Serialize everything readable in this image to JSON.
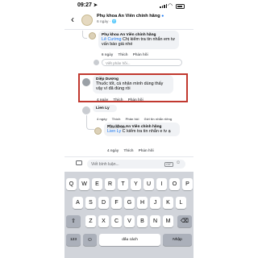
{
  "status_bar": {
    "time": "09:27",
    "arrow": "➤"
  },
  "header": {
    "back": "‹",
    "page_name": "Phụ khoa An Viên chính hãng",
    "verified": "●",
    "meta": "6 ngày · 🌐"
  },
  "comments": {
    "brand_reply": {
      "author": "Phụ khoa An Viên chính hãng",
      "mention": "Lê Cường",
      "text": " Chị kiểm tra tin nhắn em tư vấn báo giá nhé",
      "actions": [
        "6 ngày",
        "Thích",
        "Phản hồi"
      ]
    },
    "reply_placeholder": "Viết phản hồi...",
    "highlighted": {
      "author": "Diệp Dương",
      "text": "Thuốc tốt, cá nhân mình dùng thấy vậy ví đã đúng rồi",
      "actions": [
        "4 ngày",
        "Thích",
        "Phản hồi"
      ]
    },
    "lien": {
      "author": "Lien Ly",
      "actions": [
        "4 ngày",
        "Thích",
        "Phản hồi",
        "Gửi tin nhắn riêng"
      ]
    },
    "brand_reply_2": {
      "badge": "Fan tích cực",
      "author": "Phụ khoa An Viên chính hãng",
      "mention": "Lien Ly",
      "text": " C kiểm tra tin nhắn e tv ạ",
      "actions": [
        "4 ngày",
        "Thích",
        "Phản hồi"
      ]
    }
  },
  "composer": {
    "placeholder": "Viết bình luận...",
    "gif": "GIF",
    "sticker": "☺"
  },
  "keyboard": {
    "row1": [
      "Q",
      "W",
      "E",
      "R",
      "T",
      "Y",
      "U",
      "I",
      "O",
      "P"
    ],
    "row2": [
      "A",
      "S",
      "D",
      "F",
      "G",
      "H",
      "J",
      "K",
      "L"
    ],
    "row3": [
      "Z",
      "X",
      "C",
      "V",
      "B",
      "N",
      "M"
    ],
    "shift": "⇧",
    "delete": "⌫",
    "numbers": "123",
    "emoji": "☺",
    "space": "dấu cách",
    "return": "Nhập"
  }
}
